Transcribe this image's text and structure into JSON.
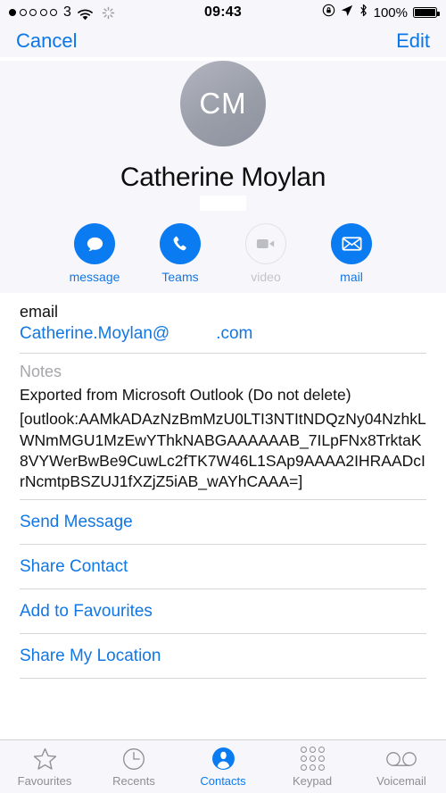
{
  "status_bar": {
    "signal_dots_total": 5,
    "signal_dots_filled": 1,
    "carrier": "3",
    "wifi_icon": "wifi-icon",
    "activity_icon": "activity-spinner-icon",
    "time": "09:43",
    "rotation_lock_icon": "rotation-lock-icon",
    "location_icon": "location-arrow-icon",
    "bluetooth_icon": "bluetooth-icon",
    "battery_percent": "100%",
    "battery_level": 100
  },
  "nav": {
    "cancel_label": "Cancel",
    "edit_label": "Edit"
  },
  "contact": {
    "initials": "CM",
    "name": "Catherine Moylan",
    "redacted_subtitle": ""
  },
  "actions": [
    {
      "id": "message",
      "label": "message",
      "icon": "message-bubble-icon",
      "enabled": true
    },
    {
      "id": "teams",
      "label": "Teams",
      "icon": "phone-icon",
      "enabled": true
    },
    {
      "id": "video",
      "label": "video",
      "icon": "video-camera-icon",
      "enabled": false
    },
    {
      "id": "mail",
      "label": "mail",
      "icon": "envelope-icon",
      "enabled": true
    }
  ],
  "email_field": {
    "label": "email",
    "value_prefix": "Catherine.Moylan@",
    "value_suffix": ".com",
    "redacted": true
  },
  "notes": {
    "label": "Notes",
    "line1": "Exported from Microsoft Outlook (Do not delete)",
    "line2": "[outlook:AAMkADAzNzBmMzU0LTI3NTItNDQzNy04NzhkLWNmMGU1MzEwYThkNABGAAAAAAB_7ILpFNx8TrktaK8VYWerBwBe9CuwLc2fTK7W46L1SAp9AAAA2IHRAADcIrNcmtpBSZUJ1fXZjZ5iAB_wAYhCAAA=]"
  },
  "links": [
    {
      "id": "send-message",
      "label": "Send Message"
    },
    {
      "id": "share-contact",
      "label": "Share Contact"
    },
    {
      "id": "add-to-favourites",
      "label": "Add to Favourites"
    },
    {
      "id": "share-my-location",
      "label": "Share My Location"
    }
  ],
  "tabs": [
    {
      "id": "favourites",
      "label": "Favourites",
      "icon": "star-icon",
      "active": false
    },
    {
      "id": "recents",
      "label": "Recents",
      "icon": "clock-icon",
      "active": false
    },
    {
      "id": "contacts",
      "label": "Contacts",
      "icon": "person-icon",
      "active": true
    },
    {
      "id": "keypad",
      "label": "Keypad",
      "icon": "keypad-icon",
      "active": false
    },
    {
      "id": "voicemail",
      "label": "Voicemail",
      "icon": "voicemail-icon",
      "active": false
    }
  ],
  "colors": {
    "accent": "#0b7bf1",
    "link": "#1177e4",
    "header_bg": "#f7f7fb",
    "muted": "#8e8e93"
  }
}
